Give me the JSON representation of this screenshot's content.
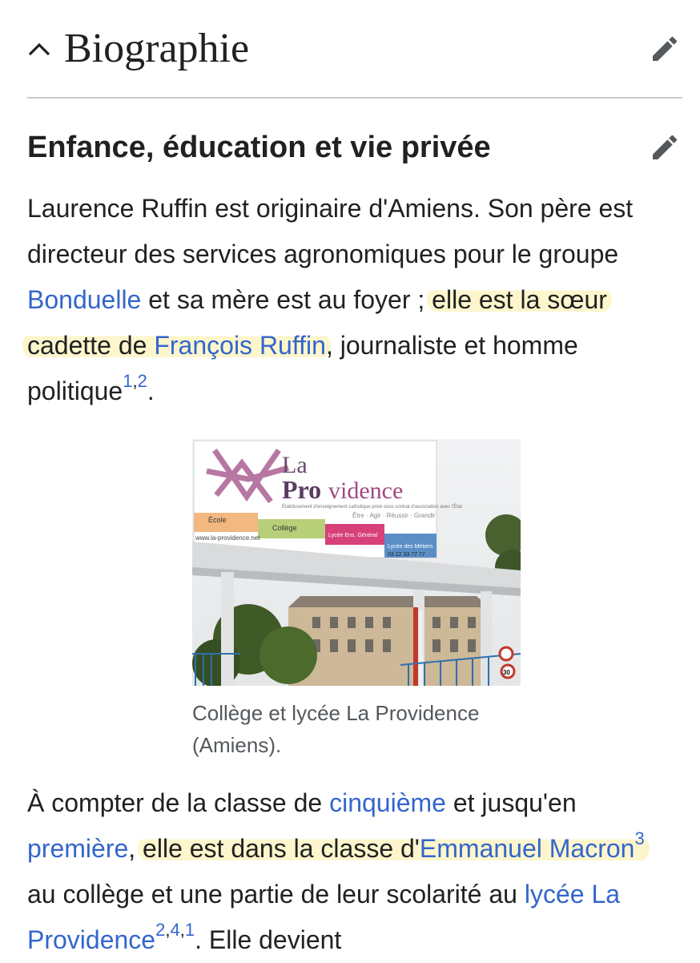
{
  "section": {
    "title": "Biographie"
  },
  "subsection": {
    "title": "Enfance, éducation et vie privée"
  },
  "paragraph1": {
    "t1": "Laurence Ruffin est originaire d'Amiens. Son père est directeur des services agronomiques pour le groupe ",
    "link_bonduelle": "Bonduelle",
    "t2": " et sa mère est au foyer ; ",
    "hl_a": "elle est la sœur cadette de ",
    "link_francois": "François Ruffin",
    "t3": ", journaliste et homme politique",
    "ref1": "1",
    "sep1": ",",
    "ref2": "2",
    "t4": "."
  },
  "figure": {
    "caption": "Collège et lycée La Providence (Amiens).",
    "sign": {
      "brand_la": "La",
      "brand_pro": "Pro",
      "brand_vidence": "vidence",
      "tagline": "Établissement d'enseignement catholique privé sous contrat d'association avec l'État",
      "motto": "Être · Agir · Réussir · Grandir",
      "ecole": "École",
      "college": "Collège",
      "lycee_gen": "Lycée Ens. Général",
      "lycee_metiers": "Lycée des Métiers",
      "website": "www.la-providence.net",
      "phone": "03 22 33 77 77",
      "speed": "30"
    }
  },
  "paragraph2": {
    "t1": "À compter de la classe de ",
    "link_cinquieme": "cinquième",
    "t2": " et jusqu'en ",
    "link_premiere": "première",
    "t3": ", ",
    "hl_a": "elle est dans la classe d'",
    "link_macron": "Emmanuel Macron",
    "ref3": "3",
    "t4": " au collège et une partie de leur scolarité au ",
    "link_lycee": "lycée La Providence",
    "ref2": "2",
    "sep1": ",",
    "ref4": "4",
    "sep2": ",",
    "ref1": "1",
    "t5": ". Elle devient"
  },
  "icons": {
    "collapse": "chevron-up-icon",
    "edit": "pencil-icon"
  },
  "colors": {
    "link": "#3366cc",
    "highlight": "#fdf6cd",
    "text": "#202122",
    "caption": "#54595d",
    "rule": "#c8ccd1"
  }
}
